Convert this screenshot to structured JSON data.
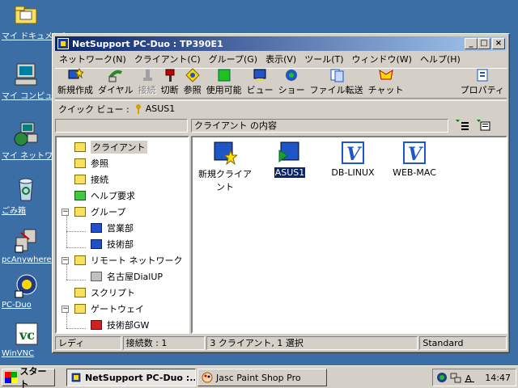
{
  "desktop": {
    "icons": [
      {
        "label": "マイ ドキュメント"
      },
      {
        "label": "マイ コンピュータ"
      },
      {
        "label": "マイ ネットワーク"
      },
      {
        "label": "ごみ箱"
      },
      {
        "label": "pcAnywhere"
      },
      {
        "label": "PC-Duo"
      },
      {
        "label": "WinVNC"
      }
    ]
  },
  "window": {
    "title": "NetSupport PC-Duo : TP390E1",
    "buttons": {
      "minimize": "_",
      "maximize": "□",
      "close": "×"
    }
  },
  "menu": [
    "ネットワーク(N)",
    "クライアント(C)",
    "グループ(G)",
    "表示(V)",
    "ツール(T)",
    "ウィンドウ(W)",
    "ヘルプ(H)"
  ],
  "toolbar": [
    {
      "label": "新規作成",
      "icon": "new-client-icon",
      "disabled": false
    },
    {
      "label": "ダイヤル",
      "icon": "dial-icon",
      "disabled": false
    },
    {
      "label": "接続",
      "icon": "connect-icon",
      "disabled": true
    },
    {
      "label": "切断",
      "icon": "disconnect-icon",
      "disabled": false
    },
    {
      "label": "参照",
      "icon": "browse-icon",
      "disabled": false
    },
    {
      "label": "使用可能",
      "icon": "available-icon",
      "disabled": false
    },
    {
      "label": "ビュー",
      "icon": "view-icon",
      "disabled": false
    },
    {
      "label": "ショー",
      "icon": "show-icon",
      "disabled": false
    },
    {
      "label": "ファイル転送",
      "icon": "file-transfer-icon",
      "disabled": false
    },
    {
      "label": "チャット",
      "icon": "chat-icon",
      "disabled": false
    },
    {
      "label": "プロパティ",
      "icon": "properties-icon",
      "disabled": false
    }
  ],
  "quickview": {
    "label": "クイック ビュー :",
    "value": "ASUS1"
  },
  "content_header": "クライアント の内容",
  "tree": [
    {
      "label": "クライアント",
      "color": "yellow",
      "selected": true
    },
    {
      "label": "参照",
      "color": "yellow"
    },
    {
      "label": "接続",
      "color": "yellow"
    },
    {
      "label": "ヘルプ要求",
      "color": "green"
    },
    {
      "label": "グループ",
      "color": "yellow"
    },
    {
      "label": "営業部",
      "color": "blue"
    },
    {
      "label": "技術部",
      "color": "blue"
    },
    {
      "label": "リモート ネットワーク",
      "color": "yellow"
    },
    {
      "label": "名古屋DialUP",
      "color": "gray"
    },
    {
      "label": "スクリプト",
      "color": "yellow"
    },
    {
      "label": "ゲートウェイ",
      "color": "yellow"
    },
    {
      "label": "技術部GW",
      "color": "red"
    }
  ],
  "clients": [
    {
      "label": "新規クライアント",
      "icon": "new-client-icon",
      "selected": false
    },
    {
      "label": "ASUS1",
      "icon": "client-connected-icon",
      "selected": true
    },
    {
      "label": "DB-LINUX",
      "icon": "vnc-client-icon",
      "selected": false
    },
    {
      "label": "WEB-MAC",
      "icon": "vnc-client-icon",
      "selected": false
    }
  ],
  "status": {
    "ready": "レディ",
    "connections": "接続数 : 1",
    "summary": "3 クライアント, 1 選択",
    "mode": "Standard"
  },
  "taskbar": {
    "start": "スタート",
    "tasks": [
      {
        "label": "NetSupport PC-Duo :...",
        "active": true
      },
      {
        "label": "Jasc Paint Shop Pro",
        "active": false
      }
    ],
    "clock": "14:47"
  },
  "colors": {
    "desktop": "#3a6ea5",
    "title_start": "#0a246a",
    "title_end": "#a6caf0",
    "face": "#d4d0c8"
  }
}
